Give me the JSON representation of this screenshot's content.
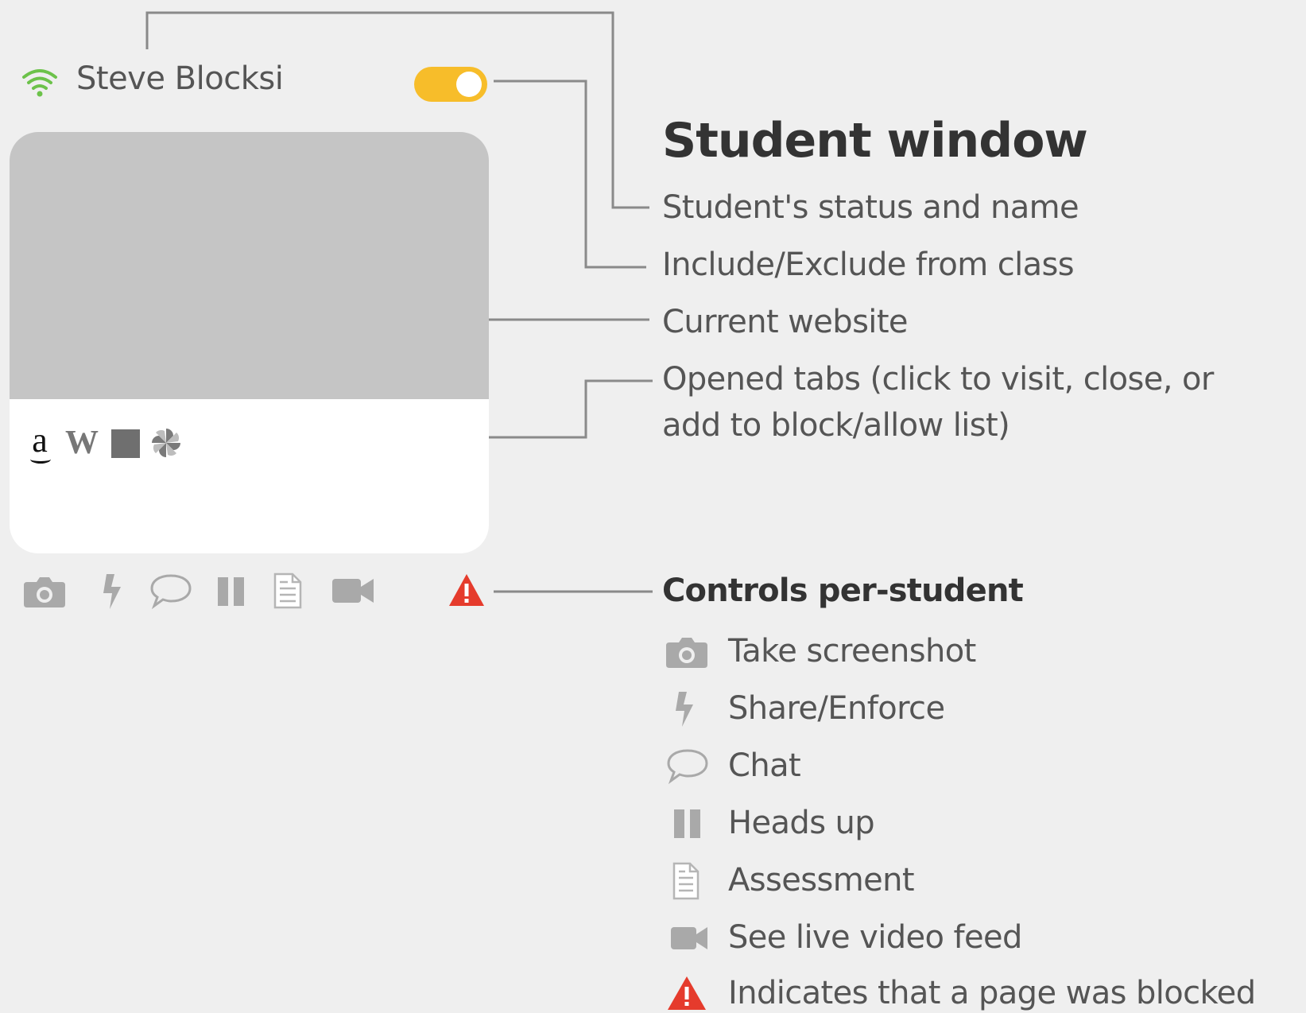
{
  "student": {
    "name": "Steve Blocksi",
    "status_icon": "wifi-icon",
    "status_color": "#6cc24a",
    "toggle_color": "#f7bd2a",
    "included": true
  },
  "card": {
    "open_tabs": [
      "amazon-tab-icon",
      "wikipedia-tab-icon",
      "image-tab-icon",
      "pinwheel-tab-icon"
    ],
    "amazon_glyph": "a",
    "wiki_glyph": "W",
    "website_color": "#c5c5c5"
  },
  "controls": [
    "camera-icon",
    "lightning-icon",
    "chat-icon",
    "pause-icon",
    "document-icon",
    "video-icon",
    "warning-icon"
  ],
  "legend": {
    "title": "Student window",
    "student_status": "Student's status and name",
    "include_exclude": "Include/Exclude from class",
    "current_website": "Current website",
    "opened_tabs_line1": "Opened tabs (click to visit, close, or",
    "opened_tabs_line2": "add to block/allow list)",
    "controls_title": "Controls per-student",
    "items": [
      {
        "icon": "camera-icon",
        "text": "Take screenshot"
      },
      {
        "icon": "lightning-icon",
        "text": "Share/Enforce"
      },
      {
        "icon": "chat-icon",
        "text": "Chat"
      },
      {
        "icon": "pause-icon",
        "text": "Heads up"
      },
      {
        "icon": "document-icon",
        "text": "Assessment"
      },
      {
        "icon": "video-icon",
        "text": "See live video feed"
      },
      {
        "icon": "warning-icon",
        "text": "Indicates that a page was blocked"
      }
    ]
  },
  "colors": {
    "icon_gray": "#a9a9a9",
    "warning_red": "#e53b2c",
    "connector": "#8a8a8a"
  }
}
